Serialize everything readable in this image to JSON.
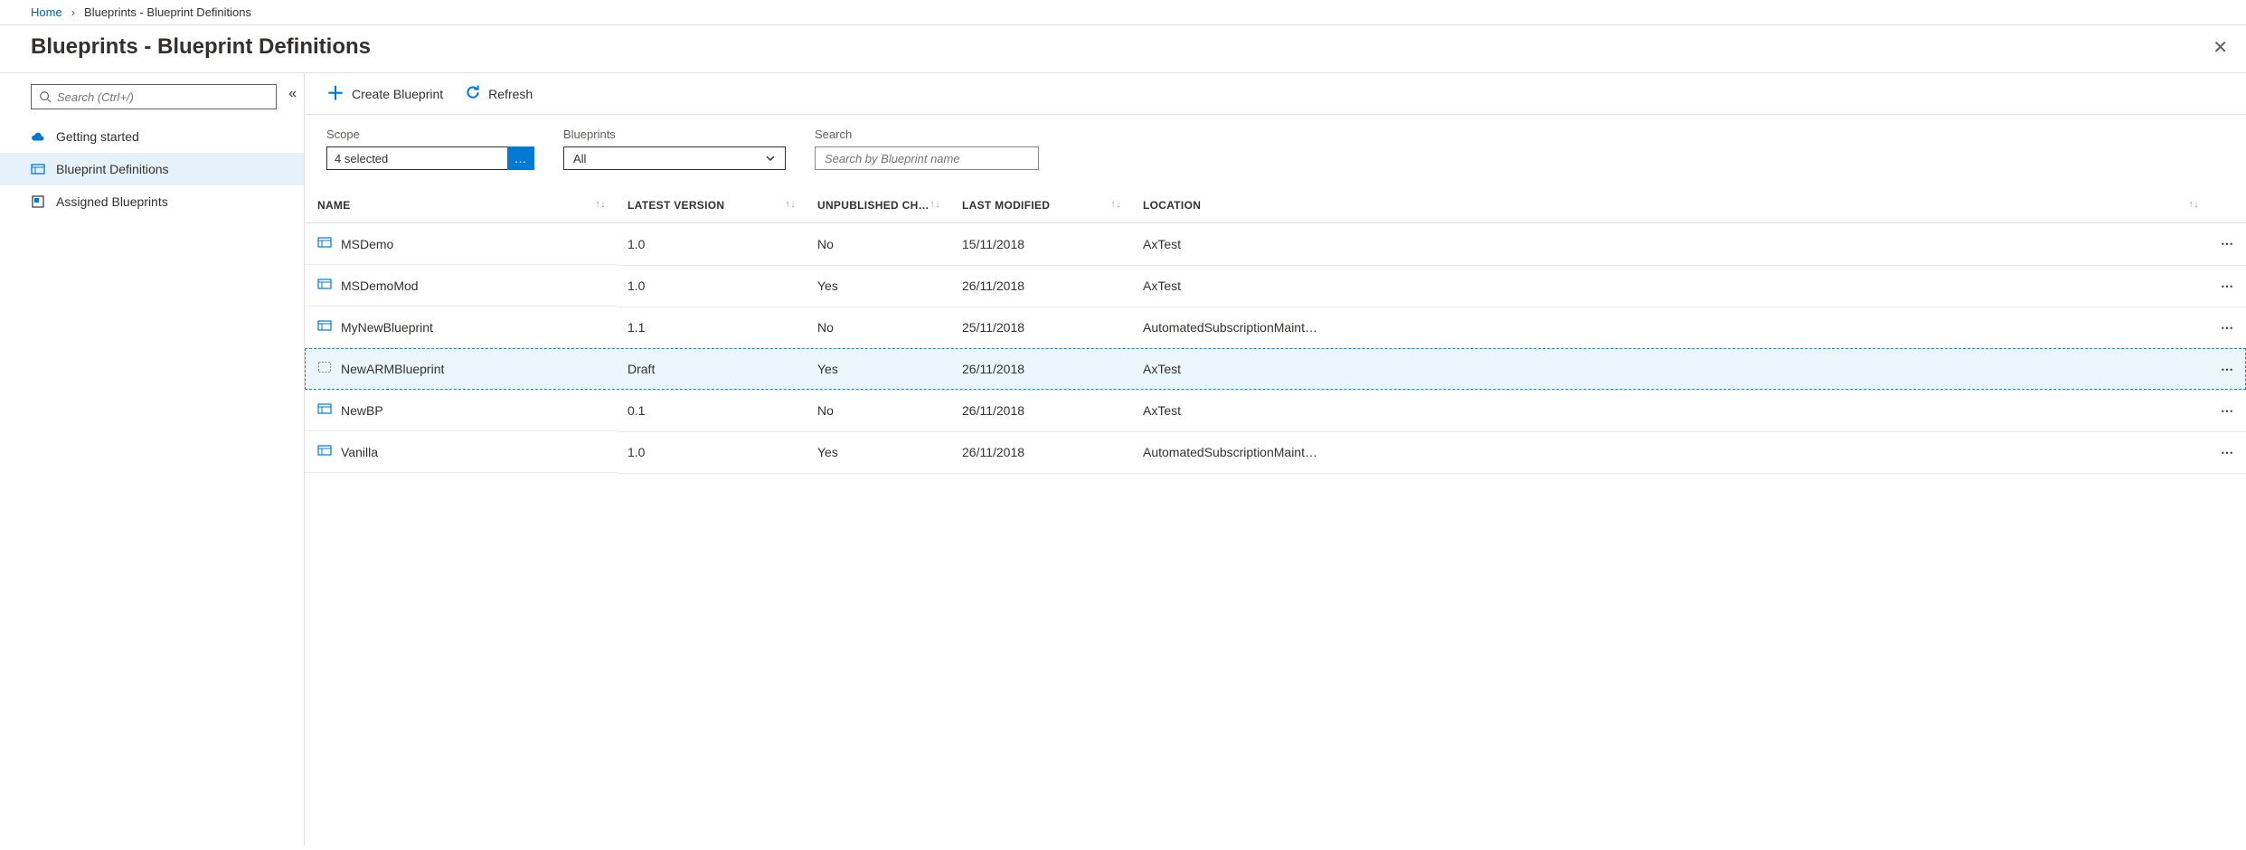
{
  "breadcrumb": {
    "home": "Home",
    "current": "Blueprints - Blueprint Definitions"
  },
  "pageTitle": "Blueprints - Blueprint Definitions",
  "sidebar": {
    "searchPlaceholder": "Search (Ctrl+/)",
    "items": [
      {
        "label": "Getting started"
      },
      {
        "label": "Blueprint Definitions"
      },
      {
        "label": "Assigned Blueprints"
      }
    ]
  },
  "toolbar": {
    "create": "Create Blueprint",
    "refresh": "Refresh"
  },
  "filters": {
    "scopeLabel": "Scope",
    "scopeValue": "4 selected",
    "blueprintsLabel": "Blueprints",
    "blueprintsValue": "All",
    "searchLabel": "Search",
    "searchPlaceholder": "Search by Blueprint name"
  },
  "columns": {
    "name": "NAME",
    "latestVersion": "LATEST VERSION",
    "unpublished": "UNPUBLISHED CH…",
    "lastModified": "LAST MODIFIED",
    "location": "LOCATION"
  },
  "rows": [
    {
      "name": "MSDemo",
      "version": "1.0",
      "unpublished": "No",
      "modified": "15/11/2018",
      "location": "AxTest",
      "selected": false,
      "draft": false
    },
    {
      "name": "MSDemoMod",
      "version": "1.0",
      "unpublished": "Yes",
      "modified": "26/11/2018",
      "location": "AxTest",
      "selected": false,
      "draft": false
    },
    {
      "name": "MyNewBlueprint",
      "version": "1.1",
      "unpublished": "No",
      "modified": "25/11/2018",
      "location": "AutomatedSubscriptionMaint…",
      "selected": false,
      "draft": false
    },
    {
      "name": "NewARMBlueprint",
      "version": "Draft",
      "unpublished": "Yes",
      "modified": "26/11/2018",
      "location": "AxTest",
      "selected": true,
      "draft": true
    },
    {
      "name": "NewBP",
      "version": "0.1",
      "unpublished": "No",
      "modified": "26/11/2018",
      "location": "AxTest",
      "selected": false,
      "draft": false
    },
    {
      "name": "Vanilla",
      "version": "1.0",
      "unpublished": "Yes",
      "modified": "26/11/2018",
      "location": "AutomatedSubscriptionMaint…",
      "selected": false,
      "draft": false
    }
  ]
}
